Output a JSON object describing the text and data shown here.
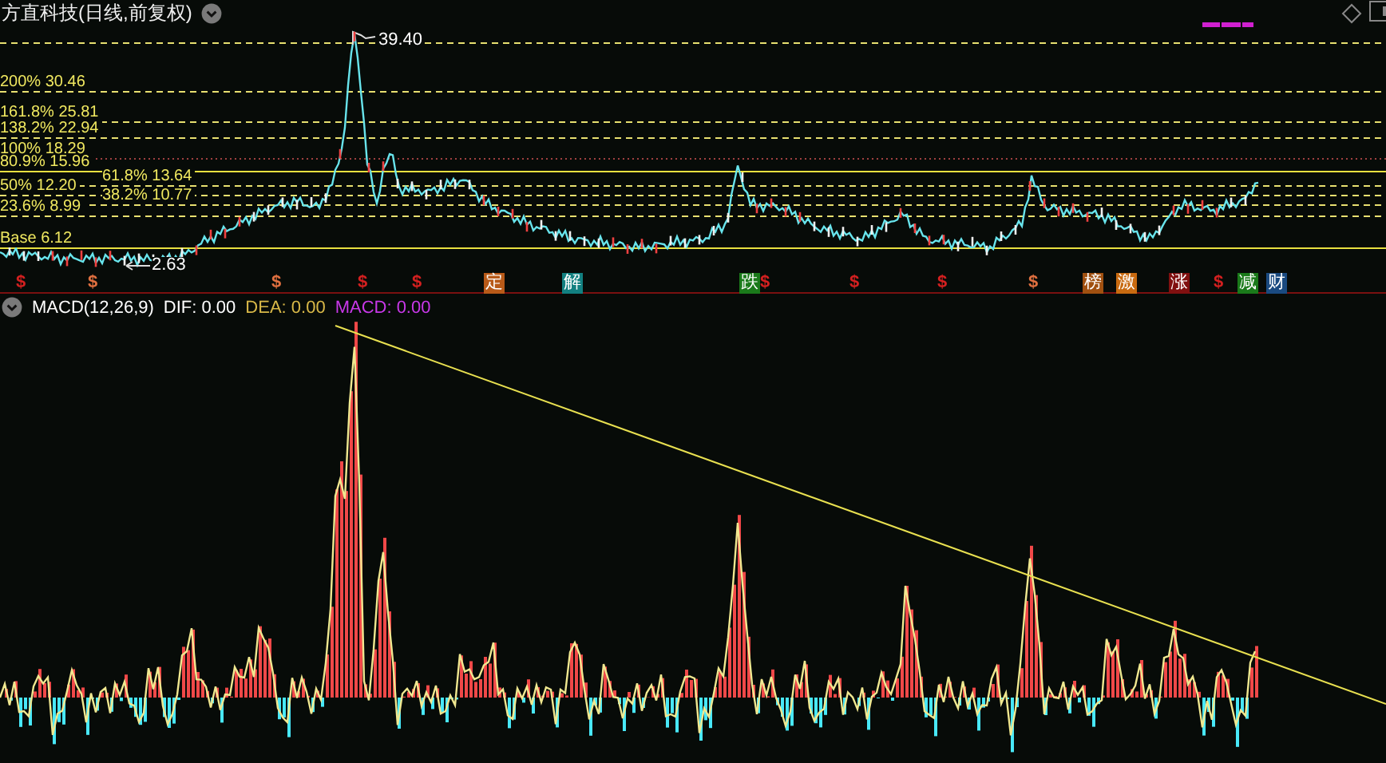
{
  "window": {
    "title": "方直科技(日线,前复权)"
  },
  "price_panel": {
    "high_label": "39.40",
    "low_label": "2.63",
    "fib_levels": [
      {
        "label": "200% 30.46",
        "kind": "dashed"
      },
      {
        "label": "161.8% 25.81",
        "kind": "dashed"
      },
      {
        "label": "138.2% 22.94",
        "kind": "dashed"
      },
      {
        "label": "100% 18.29",
        "kind": "dotted"
      },
      {
        "label": "80.9% 15.96",
        "kind": "solid"
      },
      {
        "label": "61.8% 13.64",
        "kind": "dashed"
      },
      {
        "label": "50% 12.20",
        "kind": "dashed"
      },
      {
        "label": "38.2% 10.77",
        "kind": "dashed"
      },
      {
        "label": "23.6% 8.99",
        "kind": "dashed"
      },
      {
        "label": "Base 6.12",
        "kind": "solid"
      }
    ]
  },
  "events": [
    {
      "kind": "dollar",
      "text": "$",
      "color": "#d42020"
    },
    {
      "kind": "dollar",
      "text": "$",
      "color": "#e07040"
    },
    {
      "kind": "dollar",
      "text": "$",
      "color": "#e07040"
    },
    {
      "kind": "dollar",
      "text": "$",
      "color": "#d42020"
    },
    {
      "kind": "dollar",
      "text": "$",
      "color": "#d42020"
    },
    {
      "kind": "tag",
      "text": "定",
      "color": "#b85a18"
    },
    {
      "kind": "tag",
      "text": "解",
      "color": "#128080"
    },
    {
      "kind": "tag",
      "text": "跌",
      "color": "#1a7a1a"
    },
    {
      "kind": "dollar",
      "text": "$",
      "color": "#d42020"
    },
    {
      "kind": "dollar",
      "text": "$",
      "color": "#d42020"
    },
    {
      "kind": "dollar",
      "text": "$",
      "color": "#d42020"
    },
    {
      "kind": "dollar",
      "text": "$",
      "color": "#e07040"
    },
    {
      "kind": "tag",
      "text": "榜",
      "color": "#a05010"
    },
    {
      "kind": "tag",
      "text": "激",
      "color": "#c86a10"
    },
    {
      "kind": "tag",
      "text": "涨",
      "color": "#801010"
    },
    {
      "kind": "dollar",
      "text": "$",
      "color": "#d42020"
    },
    {
      "kind": "tag",
      "text": "减",
      "color": "#1a7a1a"
    },
    {
      "kind": "tag",
      "text": "财",
      "color": "#1a4a80"
    }
  ],
  "macd_panel": {
    "title": "MACD(12,26,9)",
    "dif": "DIF: 0.00",
    "dea": "DEA: 0.00",
    "macd": "MACD: 0.00"
  }
}
